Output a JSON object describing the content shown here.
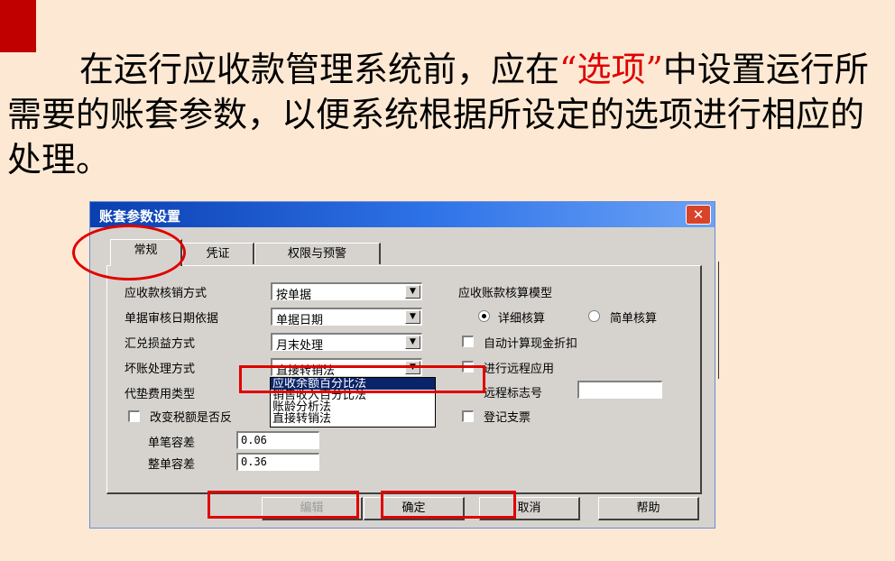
{
  "slide": {
    "para_before": "在运行应收款管理系统前，应在",
    "para_highlight": "“选项”",
    "para_after": "中设置运行所需要的账套参数，以便系统根据所设定的选项进行相应的处理。",
    "accent_color": "#c00000",
    "highlight_color": "#e00000",
    "background_color": "#fde9d3"
  },
  "dialog": {
    "title": "账套参数设置",
    "close_icon": "close-icon",
    "tabs": [
      {
        "label": "常规",
        "active": true
      },
      {
        "label": "凭证",
        "active": false
      },
      {
        "label": "权限与预警",
        "active": false
      }
    ],
    "left": {
      "writeoff_label": "应收款核销方式",
      "writeoff_value": "按单据",
      "approval_date_label": "单据审核日期依据",
      "approval_date_value": "单据日期",
      "fx_label": "汇兑损益方式",
      "fx_value": "月末处理",
      "baddebt_label": "坏账处理方式",
      "baddebt_value": "直接转销法",
      "advance_label": "代垫费用类型",
      "tax_change_label": "改变税额是否反",
      "single_tol_label": "单笔容差",
      "single_tol_value": "0.06",
      "whole_tol_label": "整单容差",
      "whole_tol_value": "0.36"
    },
    "dropdown_options": [
      "应收余额百分比法",
      "销售收入百分比法",
      "账龄分析法",
      "直接转销法"
    ],
    "right": {
      "model_label": "应收账款核算模型",
      "radio_detail": "详细核算",
      "radio_simple": "简单核算",
      "auto_discount": "自动计算现金折扣",
      "remote_app": "进行远程应用",
      "remote_flag_label": "远程标志号",
      "register_invoice": "登记支票"
    },
    "buttons": {
      "edit": "编辑",
      "ok": "确定",
      "cancel": "取消",
      "help": "帮助"
    }
  }
}
